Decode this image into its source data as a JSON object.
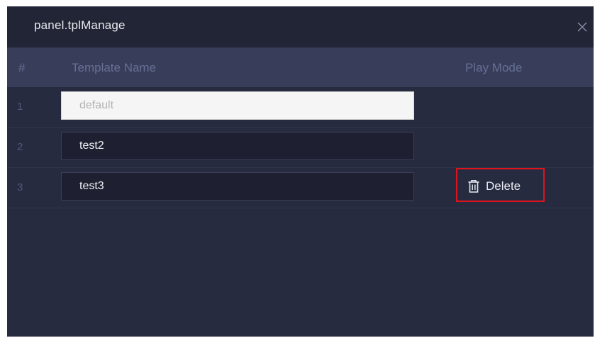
{
  "dialog": {
    "title": "panel.tplManage",
    "close_icon": "close-icon"
  },
  "table": {
    "columns": [
      "#",
      "Template Name",
      "Play Mode"
    ],
    "rows": [
      {
        "index": "1",
        "name": "default",
        "editable": false,
        "action": null
      },
      {
        "index": "2",
        "name": "test2",
        "editable": true,
        "action": null
      },
      {
        "index": "3",
        "name": "test3",
        "editable": true,
        "action": {
          "label": "Delete",
          "icon": "trash-icon"
        }
      }
    ]
  },
  "colors": {
    "dialog_bg": "#272b40",
    "titlebar_bg": "#222536",
    "header_bg": "#383d59",
    "highlight": "#e0131c"
  }
}
